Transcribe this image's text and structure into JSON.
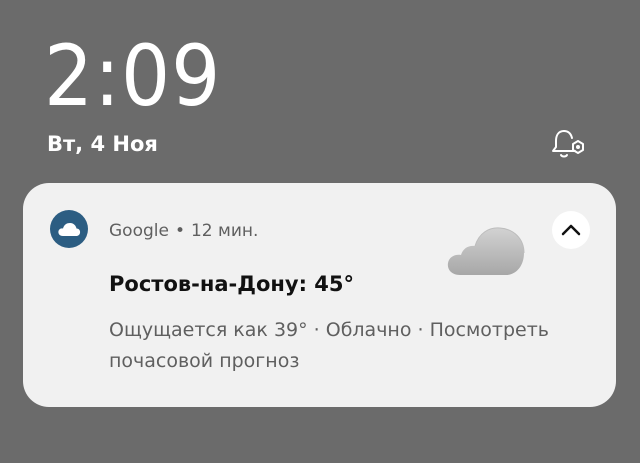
{
  "lockscreen": {
    "time": "2:09",
    "date": "Вт, 4 Ноя"
  },
  "status_icons": {
    "dnd_icon": "bell-gear-icon"
  },
  "notification": {
    "app_name": "Google",
    "separator": "•",
    "time_ago": "12 мин.",
    "app_icon": "cloud-icon",
    "app_icon_color": "#2c5d82",
    "title": "Ростов-на-Дону: 45°",
    "body": "Ощущается как 39° · Облачно · Посмотреть почасовой прогноз",
    "expand_icon": "chevron-up-icon",
    "weather_image": "cloud-icon"
  },
  "colors": {
    "background": "#6b6b6b",
    "card": "#f1f1f1",
    "accent": "#2c5d82"
  }
}
